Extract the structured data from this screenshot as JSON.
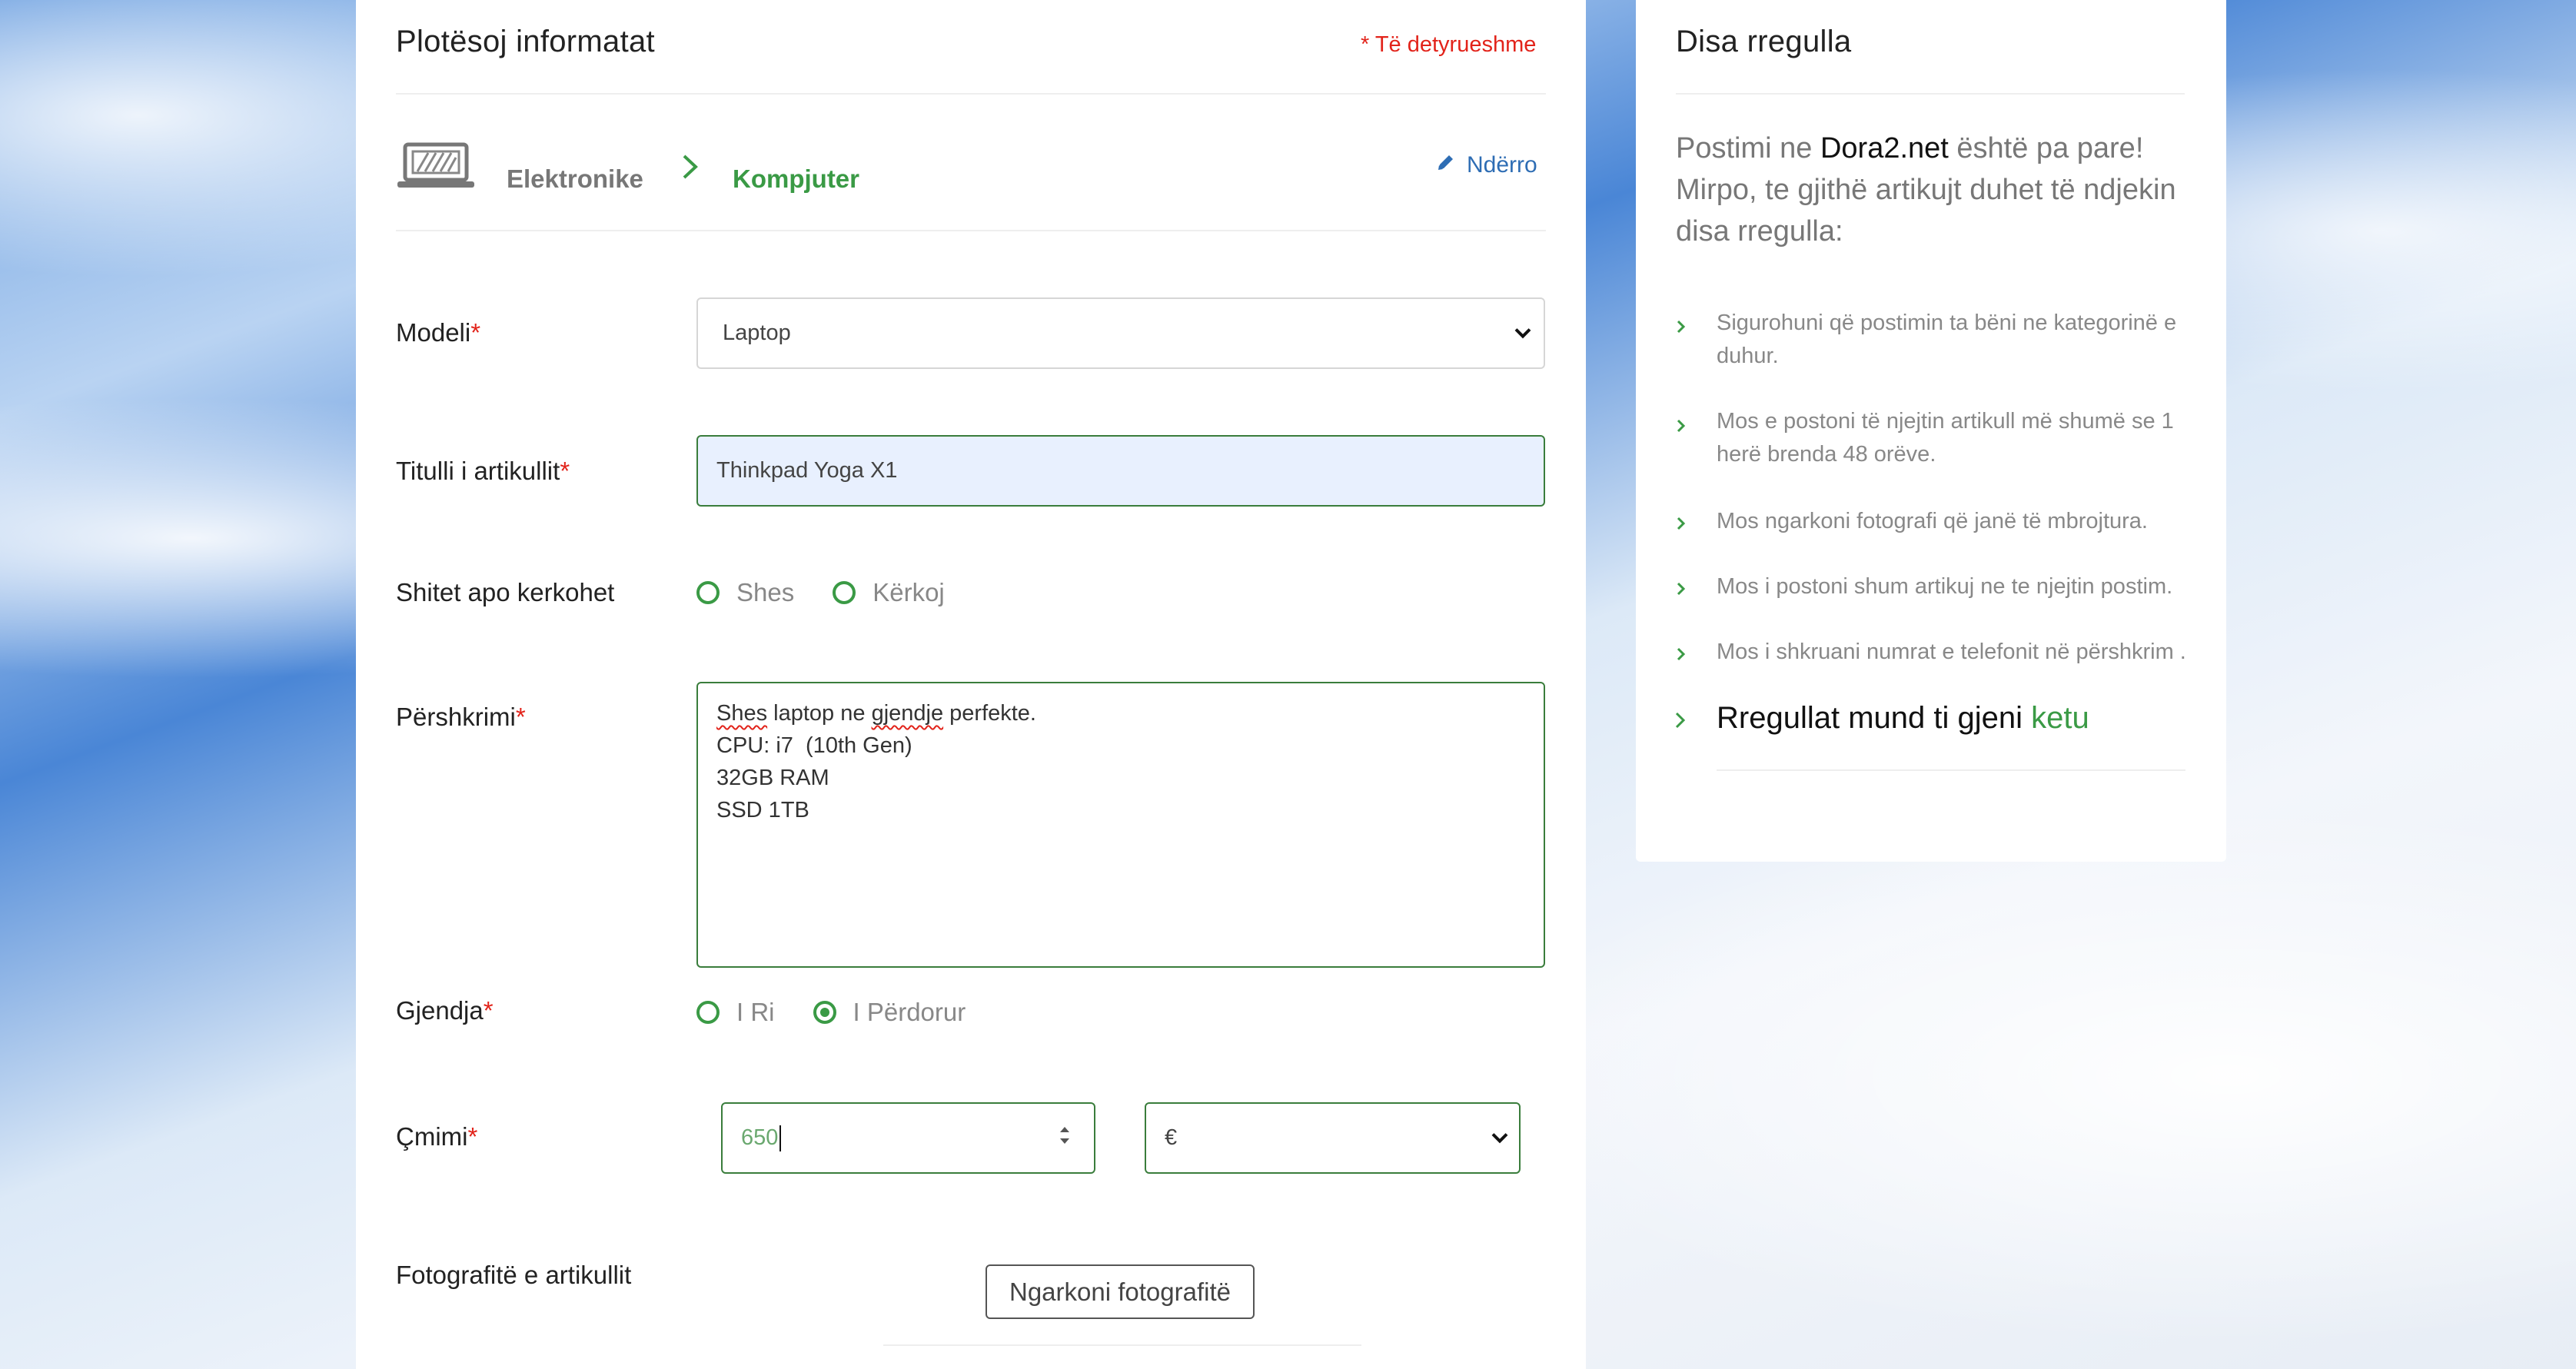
{
  "form": {
    "title": "Plotësoj informatat",
    "required_note": "* Të detyrueshme",
    "category": {
      "parent": "Elektronike",
      "child": "Kompjuter",
      "change_label": "Ndërro",
      "icon": "laptop-icon"
    },
    "fields": {
      "model": {
        "label": "Modeli",
        "star": "*",
        "value": "Laptop"
      },
      "title": {
        "label": "Titulli i artikullit",
        "star": "*",
        "value": "Thinkpad Yoga X1"
      },
      "type": {
        "label": "Shitet apo kerkohet",
        "options": [
          "Shes",
          "Kërkoj"
        ],
        "selected": null
      },
      "description": {
        "label": "Përshkrimi",
        "star": "*",
        "lines": [
          "Shes laptop ne gjendje perfekte.",
          "CPU: i7  (10th Gen)",
          "32GB RAM",
          "SSD 1TB"
        ]
      },
      "condition": {
        "label": "Gjendja",
        "star": "*",
        "options": [
          "I Ri",
          "I Përdorur"
        ],
        "selected": "I Përdorur"
      },
      "price": {
        "label": "Çmimi",
        "star": "*",
        "value": "650",
        "currency": "€"
      },
      "photos": {
        "label": "Fotografitë e artikullit",
        "button": "Ngarkoni fotografitë"
      }
    }
  },
  "rules": {
    "title": "Disa rregulla",
    "intro_prefix": "Postimi ne ",
    "intro_brand": "Dora2.net",
    "intro_suffix": " është pa pare! Mirpo, te gjithë artikujt duhet të ndjekin disa rregulla:",
    "items": [
      "Sigurohuni që postimin ta bëni ne kategorinë e duhur.",
      "Mos e postoni të njejtin artikull më shumë se 1 herë brenda 48 orëve.",
      "Mos ngarkoni fotografi që janë të mbrojtura.",
      "Mos i postoni shum artikuj ne te njejtin postim.",
      "Mos i shkruani numrat e telefonit në përshkrim ."
    ],
    "final_text": "Rregullat mund ti gjeni ",
    "final_link": "ketu"
  },
  "colors": {
    "accent_green": "#3a9a45",
    "required_red": "#e2231a",
    "link_blue": "#2e6db4",
    "input_focus_bg": "#e8f0fe"
  }
}
